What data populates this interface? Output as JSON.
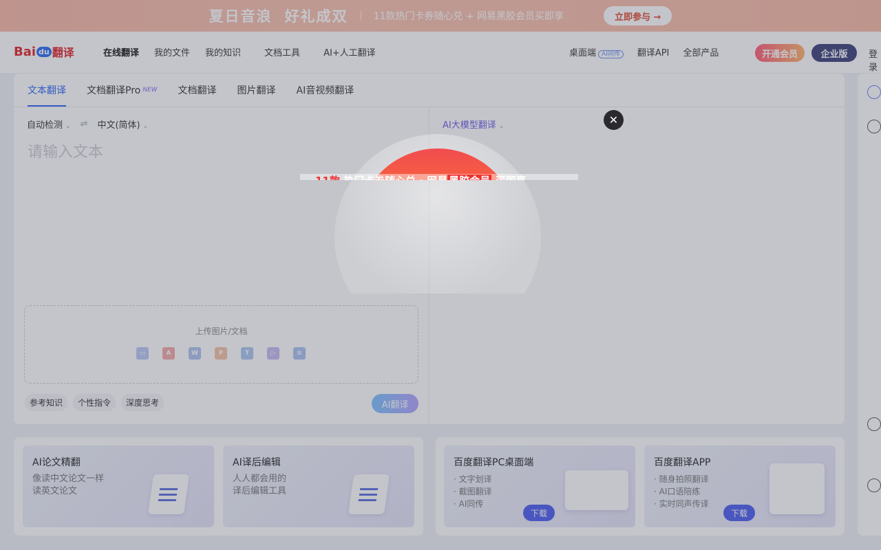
{
  "promo": {
    "title_part1": "夏日音浪",
    "title_part2": "好礼成双",
    "text": "11款热门卡券随心兑 + 网易黑胶会员买即享",
    "button": "立即参与 →"
  },
  "header": {
    "logo_bai": "Bai",
    "logo_du": "du",
    "logo_fanyi": "翻译",
    "nav": [
      "在线翻译",
      "我的文件",
      "我的知识",
      "文档工具",
      "AI+人工翻译"
    ],
    "desktop": "桌面端",
    "desktop_badge": "AI同传",
    "api": "翻译API",
    "all_products": "全部产品",
    "vip": "开通会员",
    "enterprise": "企业版",
    "login": "登录"
  },
  "translate": {
    "tabs": [
      "文本翻译",
      "文档翻译Pro",
      "文档翻译",
      "图片翻译",
      "AI音视频翻译"
    ],
    "new_badge": "NEW",
    "source_lang": "自动检测",
    "swap": "⇌",
    "target_lang": "中文(简体)",
    "input_placeholder": "请输入文本",
    "model": "AI大模型翻译",
    "upload_label": "上传图片/文档",
    "options": [
      "参考知识",
      "个性指令",
      "深度思考"
    ],
    "translate_button": "AI翻译"
  },
  "cards": [
    {
      "title": "AI论文精翻",
      "lines": [
        "像读中文论文一样",
        "读英文论文"
      ]
    },
    {
      "title": "AI译后编辑",
      "lines": [
        "人人都会用的",
        "译后编辑工具"
      ]
    },
    {
      "title": "百度翻译PC桌面端",
      "lines": [
        "· 文字划译",
        "· 截图翻译",
        "· AI同传"
      ],
      "button": "下载"
    },
    {
      "title": "百度翻译APP",
      "lines": [
        "· 随身拍照翻译",
        "· AI口语陪练",
        "· 实时同声传译"
      ],
      "button": "下载"
    }
  ],
  "popup": {
    "close": "✕",
    "text_a": "11款",
    "text_b": " 热门卡券随心兑 · 网易",
    "text_c": "黑胶会员",
    "text_d": " 买即享"
  },
  "colors": {
    "accent": "#2a63f4",
    "brand_red": "#e0232a"
  }
}
